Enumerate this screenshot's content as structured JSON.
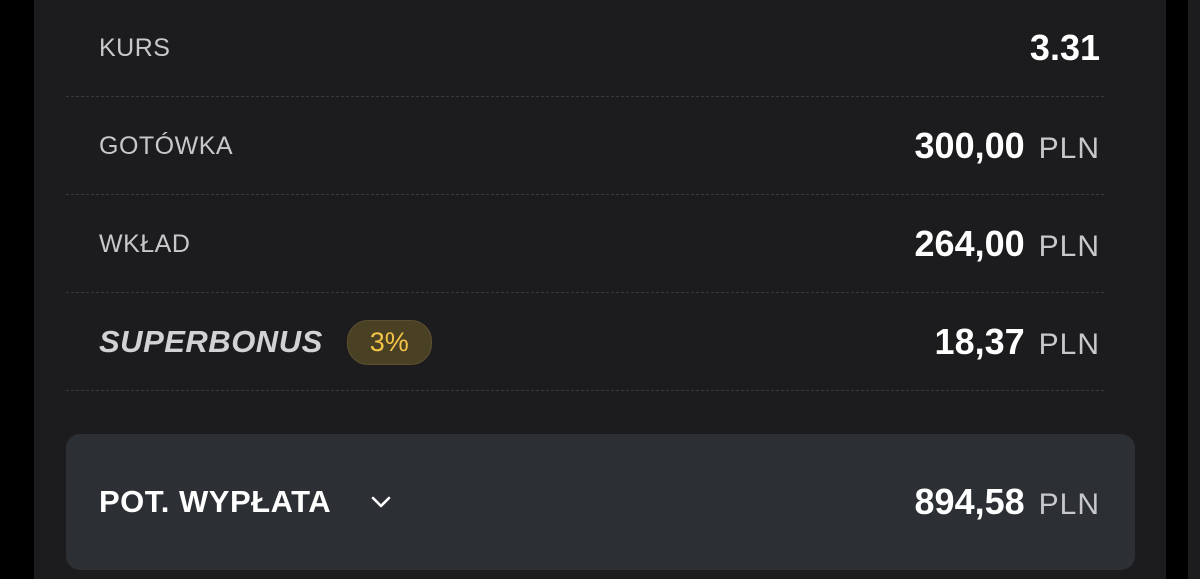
{
  "rows": {
    "kurs": {
      "label": "KURS",
      "value": "3.31"
    },
    "gotowka": {
      "label": "GOTÓWKA",
      "value": "300,00",
      "currency": "PLN"
    },
    "wklad": {
      "label": "WKŁAD",
      "value": "264,00",
      "currency": "PLN"
    },
    "superbonus": {
      "label": "SUPERBONUS",
      "badge": "3%",
      "value": "18,37",
      "currency": "PLN"
    }
  },
  "payout": {
    "label": "POT. WYPŁATA",
    "icon": "chevron-down-icon",
    "value": "894,58",
    "currency": "PLN"
  },
  "colors": {
    "background": "#1c1c1e",
    "payout_panel": "#2c2f33",
    "badge_bg": "#4a4023",
    "badge_text": "#f3c346"
  }
}
